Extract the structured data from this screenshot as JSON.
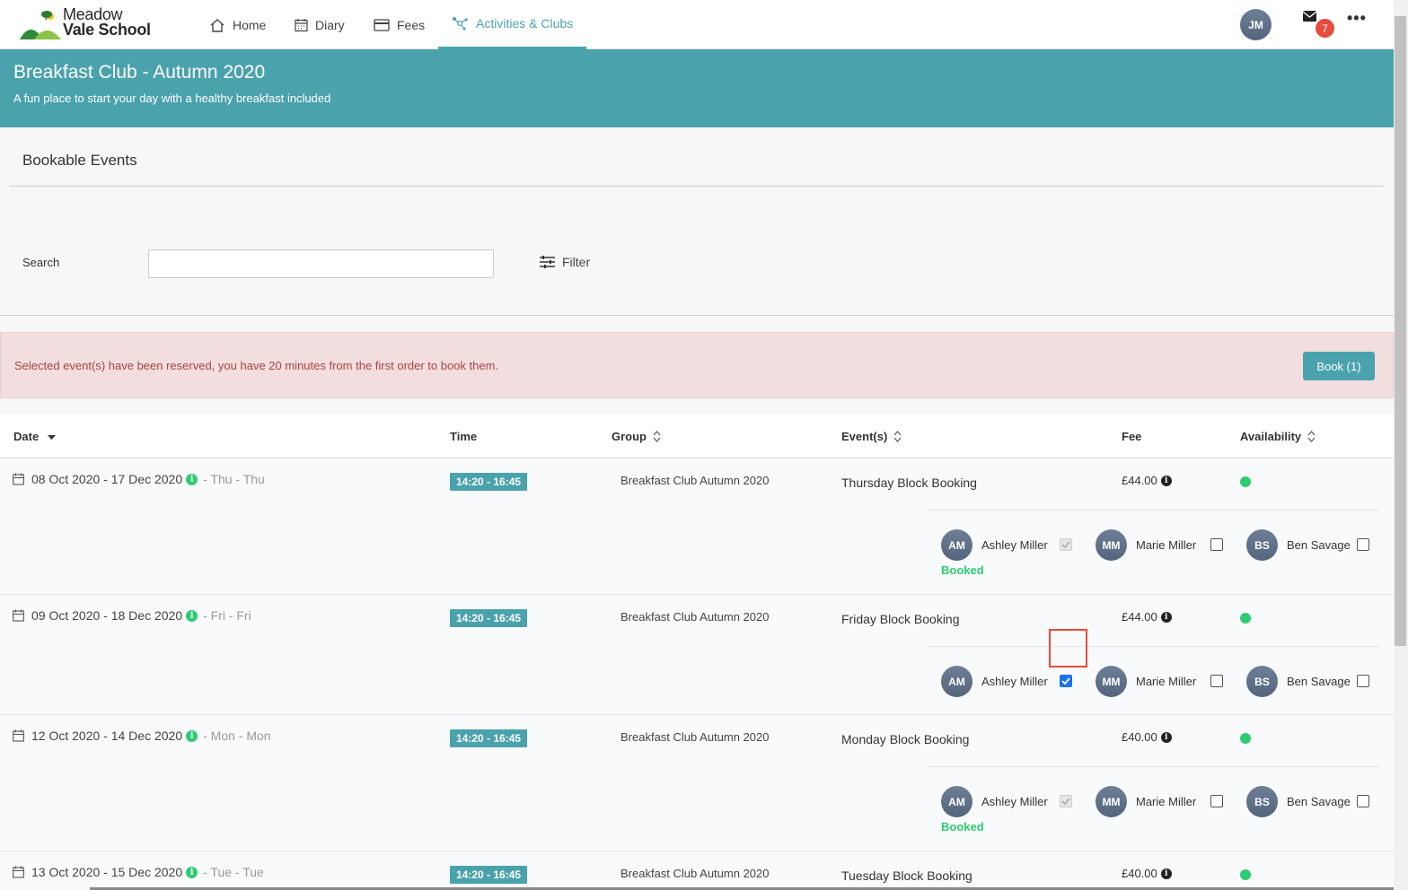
{
  "nav": {
    "logo_line1": "Meadow",
    "logo_line2": "Vale School",
    "home": "Home",
    "diary": "Diary",
    "fees": "Fees",
    "activities": "Activities & Clubs",
    "user_initials": "JM",
    "mail_count": "7",
    "more": "•••"
  },
  "banner": {
    "title": "Breakfast Club - Autumn 2020",
    "subtitle": "A fun place to start your day with a healthy breakfast included"
  },
  "section": {
    "title": "Bookable Events",
    "search_label": "Search",
    "search_value": "",
    "filter_label": "Filter"
  },
  "alert": {
    "message": "Selected event(s) have been reserved, you have 20 minutes from the first order to book them.",
    "book_label": "Book (1)"
  },
  "table": {
    "headers": {
      "date": "Date",
      "time": "Time",
      "group": "Group",
      "events": "Event(s)",
      "fee": "Fee",
      "availability": "Availability"
    },
    "rows": [
      {
        "dates": "08 Oct 2020 - 17 Dec 2020",
        "days": "- Thu - Thu",
        "time": "14:20  - 16:45",
        "group": "Breakfast Club Autumn 2020",
        "event": "Thursday Block Booking",
        "fee": "£44.00",
        "children": [
          {
            "initials": "AM",
            "name": "Ashley Miller",
            "state": "booked"
          },
          {
            "initials": "MM",
            "name": "Marie Miller",
            "state": "unchecked"
          },
          {
            "initials": "BS",
            "name": "Ben Savage",
            "state": "unchecked"
          }
        ],
        "booked_label": "Booked"
      },
      {
        "dates": "09 Oct 2020 - 18 Dec 2020",
        "days": "- Fri - Fri",
        "time": "14:20  - 16:45",
        "group": "Breakfast Club Autumn 2020",
        "event": "Friday Block Booking",
        "fee": "£44.00",
        "children": [
          {
            "initials": "AM",
            "name": "Ashley Miller",
            "state": "checked"
          },
          {
            "initials": "MM",
            "name": "Marie Miller",
            "state": "unchecked"
          },
          {
            "initials": "BS",
            "name": "Ben Savage",
            "state": "unchecked"
          }
        ]
      },
      {
        "dates": "12 Oct 2020 - 14 Dec 2020",
        "days": "- Mon - Mon",
        "time": "14:20  - 16:45",
        "group": "Breakfast Club Autumn 2020",
        "event": "Monday Block Booking",
        "fee": "£40.00",
        "children": [
          {
            "initials": "AM",
            "name": "Ashley Miller",
            "state": "booked"
          },
          {
            "initials": "MM",
            "name": "Marie Miller",
            "state": "unchecked"
          },
          {
            "initials": "BS",
            "name": "Ben Savage",
            "state": "unchecked"
          }
        ],
        "booked_label": "Booked"
      },
      {
        "dates": "13 Oct 2020 - 15 Dec 2020",
        "days": "- Tue - Tue",
        "time": "14:20  - 16:45",
        "group": "Breakfast Club Autumn 2020",
        "event": "Tuesday Block Booking",
        "fee": "£40.00"
      }
    ]
  },
  "colors": {
    "brand": "#4aa2ad",
    "success": "#2ecc71",
    "danger": "#e74c3c",
    "alert_bg": "#f2dede"
  }
}
